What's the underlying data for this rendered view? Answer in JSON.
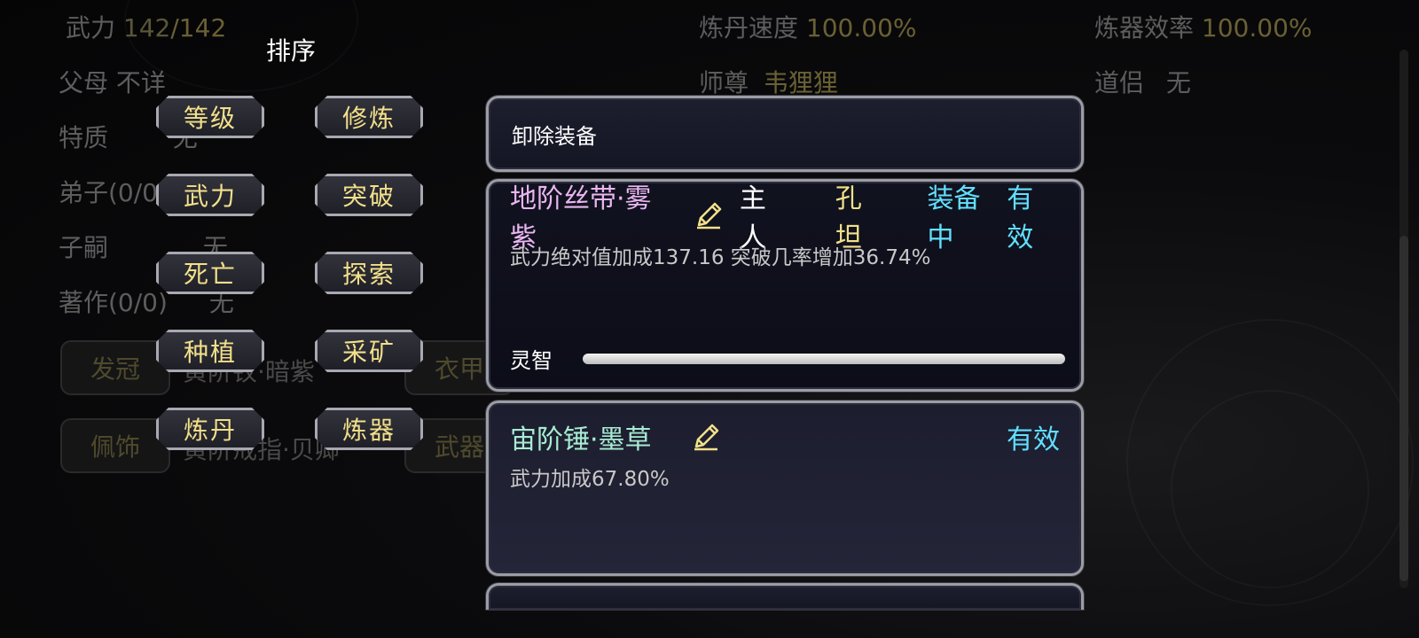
{
  "background": {
    "stats": {
      "force_label": "武力",
      "force_current": "142",
      "force_max": "/142",
      "alchemy_speed_label": "炼丹速度",
      "alchemy_speed_value": "100.00%",
      "forge_eff_label": "炼器效率",
      "forge_eff_value": "100.00%",
      "parents_label": "父母",
      "parents_value": "不详",
      "master_label": "师尊",
      "master_value": "韦狸狸",
      "partner_label": "道侣",
      "partner_value": "无",
      "trait_label": "特质",
      "trait_value": "无",
      "disciples_label": "弟子(0/0)",
      "heirs_label": "子嗣",
      "heirs_value": "无",
      "works_label": "著作(0/0)",
      "works_value": "无"
    },
    "slots": [
      {
        "label": "发冠",
        "item": "黄阶钗·暗紫"
      },
      {
        "label": "佩饰",
        "item": "黄阶戒指·贝卿"
      },
      {
        "label": "衣甲",
        "item": ""
      },
      {
        "label": "武器",
        "item": ""
      }
    ]
  },
  "sort_panel": {
    "title": "排序",
    "buttons": [
      "等级",
      "修炼",
      "武力",
      "突破",
      "死亡",
      "探索",
      "种植",
      "采矿",
      "炼丹",
      "炼器"
    ]
  },
  "equipment_panel": {
    "unequip_label": "卸除装备",
    "items": [
      {
        "name": "地阶丝带·雾紫",
        "owner_label": "主人",
        "owner_name": "孔坦",
        "status": "装备中",
        "validity": "有效",
        "description": "武力绝对值加成137.16 突破几率增加36.74%",
        "spirit_label": "灵智",
        "spirit_fraction": 1.0
      },
      {
        "name": "宙阶锤·墨草",
        "validity": "有效",
        "description": "武力加成67.80%"
      }
    ]
  },
  "colors": {
    "accent_gold": "#f2e08a",
    "valid_cyan": "#61e0ff",
    "item_purple": "#e9b6f0",
    "item_green": "#a7ecd2"
  },
  "icons": {
    "edit": "pencil-icon"
  }
}
